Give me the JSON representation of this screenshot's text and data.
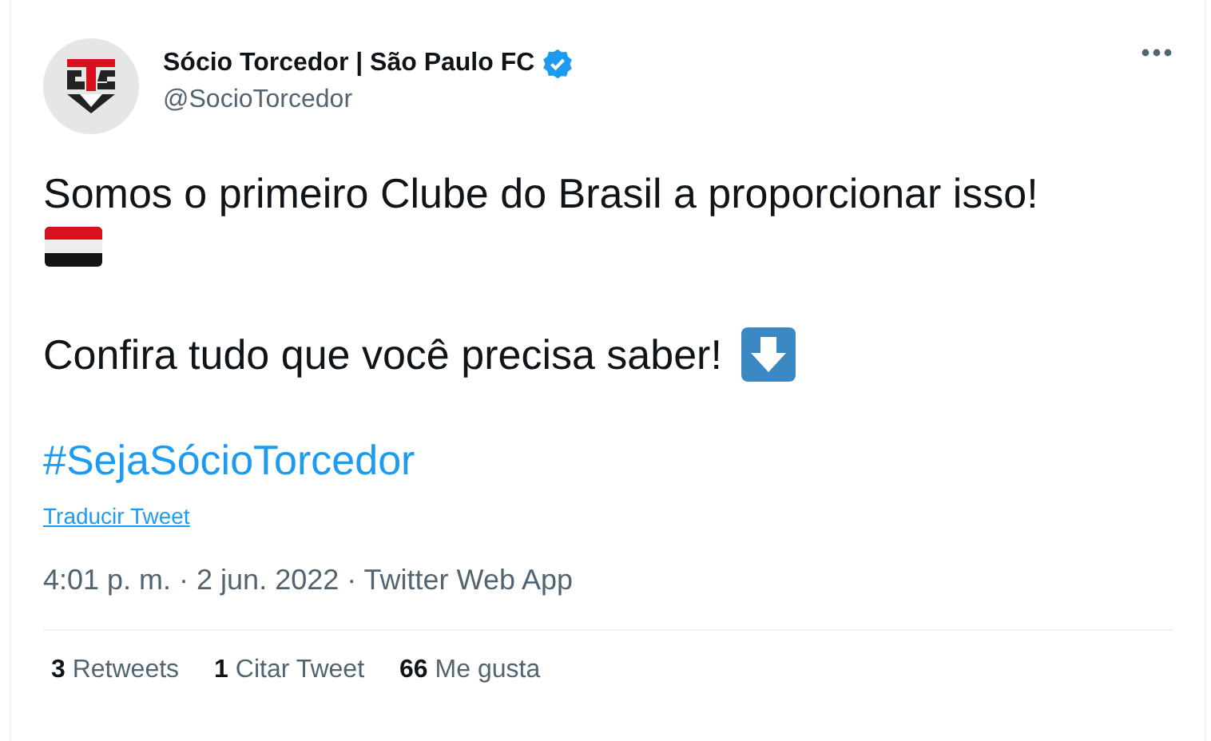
{
  "author": {
    "name": "Sócio Torcedor | São Paulo FC",
    "handle": "@SocioTorcedor",
    "verified": true
  },
  "tweet": {
    "line_1": "Somos o primeiro Clube do Brasil a proporcionar isso!",
    "line_2": "Confira tudo que você precisa saber!",
    "hashtag": "#SejaSócioTorcedor"
  },
  "translate_link": "Traducir Tweet",
  "timestamp": "4:01 p. m. · 2 jun. 2022 · Twitter Web App",
  "stats": [
    {
      "text": "**3** Retweets"
    },
    {
      "text": "**1** Citar Tweet"
    },
    {
      "text": "**66** Me gusta"
    }
  ]
}
